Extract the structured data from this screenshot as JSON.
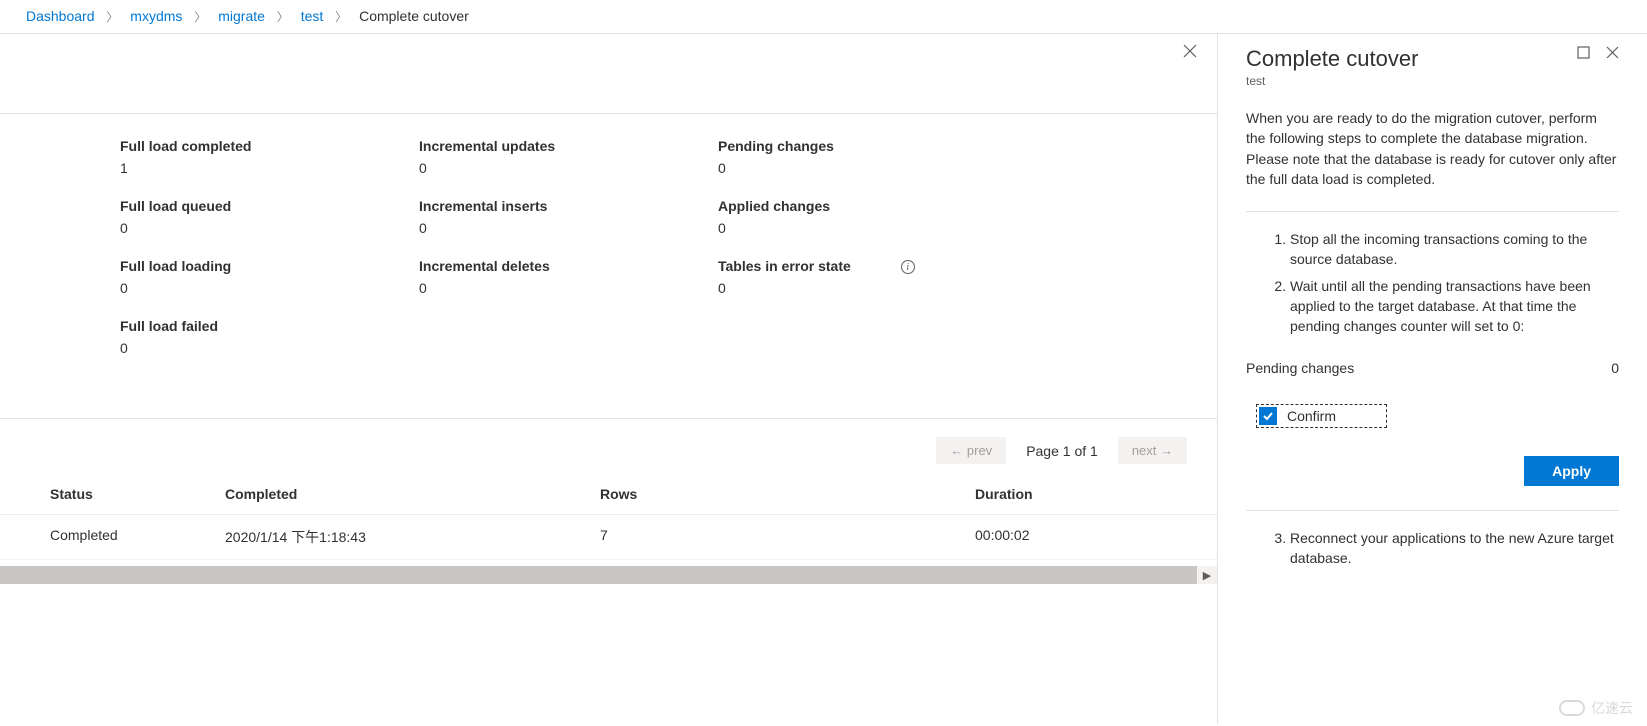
{
  "breadcrumb": {
    "items": [
      "Dashboard",
      "mxydms",
      "migrate",
      "test"
    ],
    "current": "Complete cutover"
  },
  "stats": {
    "col1": [
      {
        "label": "Full load completed",
        "value": "1"
      },
      {
        "label": "Full load queued",
        "value": "0"
      },
      {
        "label": "Full load loading",
        "value": "0"
      },
      {
        "label": "Full load failed",
        "value": "0"
      }
    ],
    "col2": [
      {
        "label": "Incremental updates",
        "value": "0"
      },
      {
        "label": "Incremental inserts",
        "value": "0"
      },
      {
        "label": "Incremental deletes",
        "value": "0"
      }
    ],
    "col3": [
      {
        "label": "Pending changes",
        "value": "0"
      },
      {
        "label": "Applied changes",
        "value": "0"
      },
      {
        "label": "Tables in error state",
        "value": "0"
      }
    ]
  },
  "pager": {
    "prev": "← prev",
    "page_text": "Page 1 of 1",
    "next": "next →"
  },
  "table": {
    "headers": {
      "status": "Status",
      "completed": "Completed",
      "rows": "Rows",
      "duration": "Duration"
    },
    "rows": [
      {
        "status": "Completed",
        "completed": "2020/1/14 下午1:18:43",
        "rows": "7",
        "duration": "00:00:02"
      }
    ]
  },
  "panel": {
    "title": "Complete cutover",
    "subtitle": "test",
    "intro": "When you are ready to do the migration cutover, perform the following steps to complete the database migration. Please note that the database is ready for cutover only after the full data load is completed.",
    "steps12": [
      "Stop all the incoming transactions coming to the source database.",
      "Wait until all the pending transactions have been applied to the target database. At that time the pending changes counter will set to 0:"
    ],
    "pending_label": "Pending changes",
    "pending_value": "0",
    "confirm_label": "Confirm",
    "apply_label": "Apply",
    "step3": "Reconnect your applications to the new Azure target database."
  },
  "watermark": "亿速云"
}
